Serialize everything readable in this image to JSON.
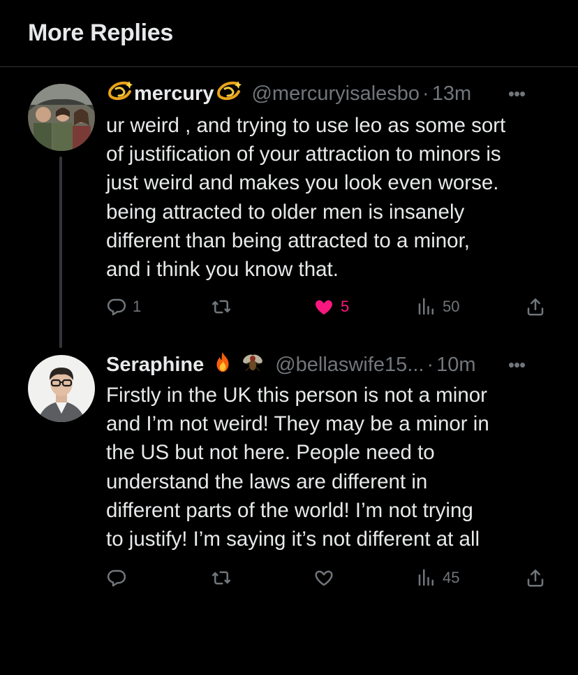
{
  "header": {
    "title": "More Replies"
  },
  "posts": [
    {
      "display_name": "mercury",
      "handle": "@mercuryisalesbo",
      "separator": "·",
      "time": "13m",
      "text": "ur weird , and trying to use leo as some sort\nof justification of your attraction to minors is\njust weird and makes you look even worse.\nbeing attracted to older men is insanely\ndifferent than being attracted to a minor,\nand i think you know that.",
      "replies": "1",
      "reposts": "",
      "likes": "5",
      "liked": true,
      "views": "50",
      "name_emojis": [
        "dizzy-icon",
        "dizzy-icon"
      ]
    },
    {
      "display_name": "Seraphine",
      "handle": "@bellaswife15...",
      "separator": "·",
      "time": "10m",
      "text": "Firstly in the UK this person is not a minor\nand I’m not weird! They may be a minor in\nthe US but not here. People need to\nunderstand the laws are different in\ndifferent parts of the world! I’m not trying\nto justify! I’m saying it’s not different at all",
      "replies": "",
      "reposts": "",
      "likes": "",
      "liked": false,
      "views": "45",
      "name_emojis": [
        "fire-icon",
        "fly-icon"
      ]
    }
  ],
  "colors": {
    "background": "#000000",
    "text": "#e7e9ea",
    "muted": "#71767b",
    "like": "#f91880",
    "divider": "#2f3336"
  }
}
